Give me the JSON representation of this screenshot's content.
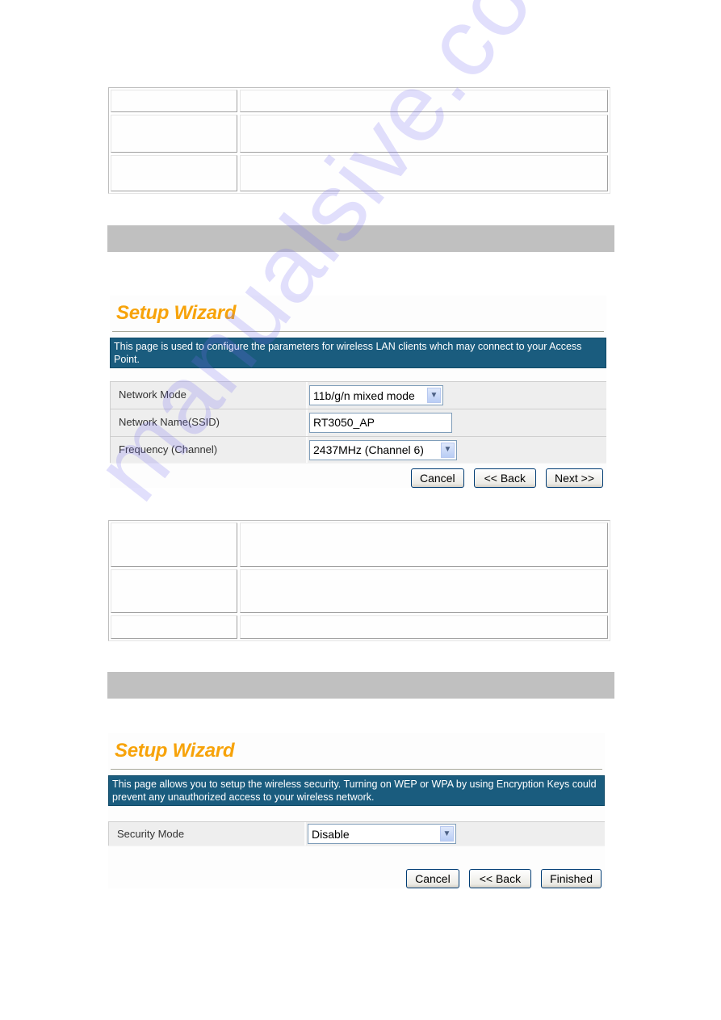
{
  "top_table": {
    "rows": [
      {
        "key": "",
        "value": ""
      },
      {
        "key": "",
        "value": ""
      },
      {
        "key": "",
        "value": ""
      }
    ]
  },
  "wizard1": {
    "title": "Setup Wizard",
    "description": "This page is used to configure the parameters for wireless LAN clients whch may connect to your Access Point.",
    "fields": [
      {
        "label": "Network Mode",
        "type": "select",
        "value": "11b/g/n mixed mode"
      },
      {
        "label": "Network Name(SSID)",
        "type": "text",
        "value": "RT3050_AP"
      },
      {
        "label": "Frequency (Channel)",
        "type": "select",
        "value": "2437MHz (Channel 6)"
      }
    ],
    "buttons": {
      "cancel": "Cancel",
      "back": "<< Back",
      "next": "Next >>"
    }
  },
  "middle_table": {
    "rows": [
      {
        "key": "",
        "value": ""
      },
      {
        "key": "",
        "value": ""
      },
      {
        "key": "",
        "value": ""
      }
    ]
  },
  "wizard2": {
    "title": "Setup Wizard",
    "description": "This page allows you to setup the wireless security. Turning on WEP or WPA by using Encryption Keys could prevent any unauthorized access to your wireless network.",
    "fields": [
      {
        "label": "Security Mode",
        "type": "select",
        "value": "Disable"
      }
    ],
    "buttons": {
      "cancel": "Cancel",
      "back": "<< Back",
      "finished": "Finished"
    }
  },
  "icons": {
    "dropdown": "chevron-down-icon"
  },
  "colors": {
    "title_orange": "#f7a30a",
    "description_bg": "#1a5c7e",
    "section_bar": "#c0c0c0"
  },
  "watermark": "manualsive.com"
}
